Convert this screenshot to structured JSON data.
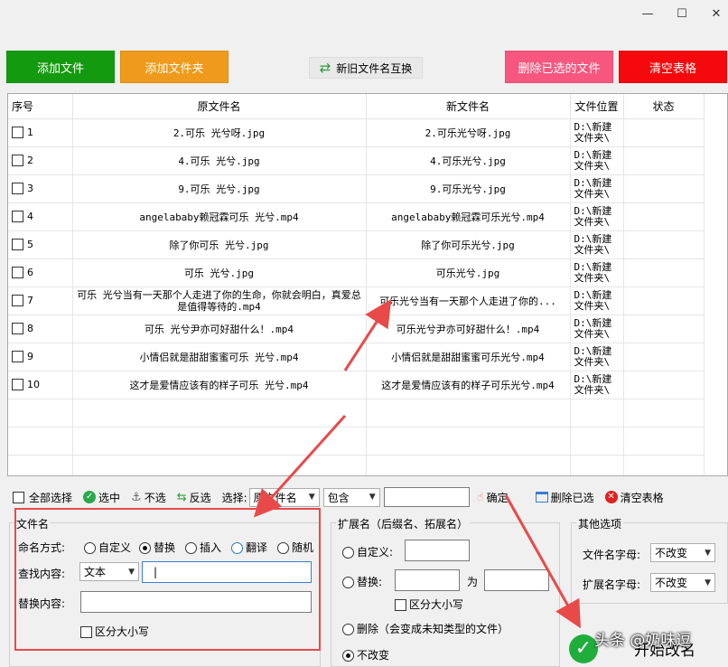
{
  "window": {
    "minimize": "—",
    "maximize": "☐",
    "close": "✕"
  },
  "top_buttons": {
    "add_file": "添加文件",
    "add_folder": "添加文件夹",
    "swap": "新旧文件名互换",
    "delete_selected": "删除已选的文件",
    "clear_table": "清空表格"
  },
  "colors": {
    "add_file": "#149a0f",
    "add_folder": "#f09a1b",
    "delete_selected": "#f7577f",
    "clear_table": "#f5090c",
    "annotation": "#e84a4a"
  },
  "table": {
    "headers": [
      "序号",
      "原文件名",
      "新文件名",
      "文件位置",
      "状态"
    ],
    "rows": [
      {
        "seq": "1",
        "original": "2.可乐  光兮呀.jpg",
        "new": "2.可乐光兮呀.jpg",
        "loc1": "D:\\新建",
        "loc2": "文件夹\\"
      },
      {
        "seq": "2",
        "original": "4.可乐  光兮.jpg",
        "new": "4.可乐光兮.jpg",
        "loc1": "D:\\新建",
        "loc2": "文件夹\\"
      },
      {
        "seq": "3",
        "original": "9.可乐  光兮.jpg",
        "new": "9.可乐光兮.jpg",
        "loc1": "D:\\新建",
        "loc2": "文件夹\\"
      },
      {
        "seq": "4",
        "original": "angelababy赖冠霖可乐  光兮.mp4",
        "new": "angelababy赖冠霖可乐光兮.mp4",
        "loc1": "D:\\新建",
        "loc2": "文件夹\\"
      },
      {
        "seq": "5",
        "original": "除了你可乐  光兮.jpg",
        "new": "除了你可乐光兮.jpg",
        "loc1": "D:\\新建",
        "loc2": "文件夹\\"
      },
      {
        "seq": "6",
        "original": "可乐  光兮.jpg",
        "new": "可乐光兮.jpg",
        "loc1": "D:\\新建",
        "loc2": "文件夹\\"
      },
      {
        "seq": "7",
        "original": "可乐  光兮当有一天那个人走进了你的生命，你就会明白，真爱总是值得等待的.mp4",
        "new": "可乐光兮当有一天那个人走进了你的...",
        "loc1": "D:\\新建",
        "loc2": "文件夹\\"
      },
      {
        "seq": "8",
        "original": "可乐  光兮尹亦可好甜什么！.mp4",
        "new": "可乐光兮尹亦可好甜什么！.mp4",
        "loc1": "D:\\新建",
        "loc2": "文件夹\\"
      },
      {
        "seq": "9",
        "original": "小情侣就是甜甜蜜蜜可乐  光兮.mp4",
        "new": "小情侣就是甜甜蜜蜜可乐光兮.mp4",
        "loc1": "D:\\新建",
        "loc2": "文件夹\\"
      },
      {
        "seq": "10",
        "original": "这才是爱情应该有的样子可乐  光兮.mp4",
        "new": "这才是爱情应该有的样子可乐光兮.mp4",
        "loc1": "D:\\新建",
        "loc2": "文件夹\\"
      }
    ]
  },
  "toolbar": {
    "select_all": "全部选择",
    "select": "选中",
    "deselect": "不选",
    "invert": "反选",
    "choose_label": "选择:",
    "field_value": "原文件名",
    "match_value": "包含",
    "confirm": "确定",
    "delete_checked": "删除已选",
    "clear_table": "清空表格"
  },
  "filename_panel": {
    "title": "文件名",
    "mode_label": "命名方式:",
    "modes": [
      "自定义",
      "替换",
      "插入",
      "翻译",
      "随机"
    ],
    "find_label": "查找内容:",
    "find_type": "文本",
    "find_value": "|",
    "replace_label": "替换内容:",
    "replace_value": "",
    "case_label": "区分大小写"
  },
  "ext_panel": {
    "title": "扩展名（后缀名、拓展名）",
    "custom": "自定义:",
    "replace": "替换:",
    "to": "为",
    "case_label": "区分大小写",
    "delete": "删除（会变成未知类型的文件）",
    "unchanged": "不改变"
  },
  "other_panel": {
    "title": "其他选项",
    "filename_case_label": "文件名字母:",
    "filename_case_value": "不改变",
    "ext_case_label": "扩展名字母:",
    "ext_case_value": "不改变"
  },
  "start": {
    "label": "开始改名"
  },
  "watermark": "头条 @奶味逗"
}
